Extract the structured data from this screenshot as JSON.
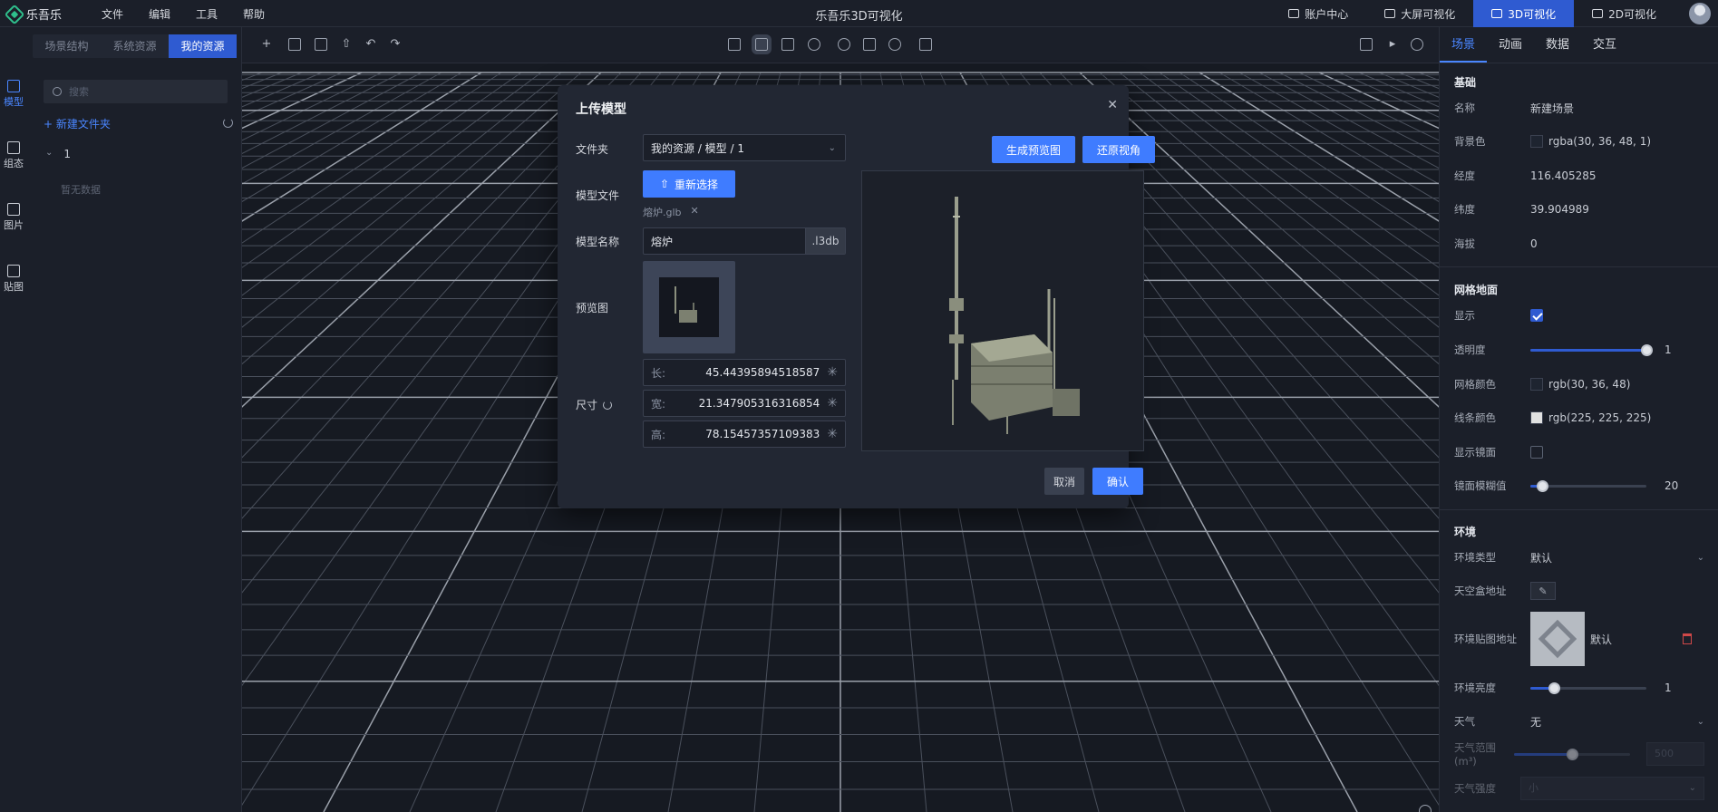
{
  "app": {
    "logo_text": "乐吾乐",
    "title": "乐吾乐3D可视化",
    "menu": [
      "文件",
      "编辑",
      "工具",
      "帮助"
    ],
    "top_links": [
      {
        "label": "账户中心",
        "active": false
      },
      {
        "label": "大屏可视化",
        "active": false
      },
      {
        "label": "3D可视化",
        "active": true
      },
      {
        "label": "2D可视化",
        "active": false
      }
    ]
  },
  "left_rail": [
    {
      "label": "模型",
      "active": true
    },
    {
      "label": "组态",
      "active": false
    },
    {
      "label": "图片",
      "active": false
    },
    {
      "label": "贴图",
      "active": false
    }
  ],
  "left_panel": {
    "tabs": [
      "场景结构",
      "系统资源",
      "我的资源"
    ],
    "active_tab": 2,
    "search_placeholder": "搜索",
    "new_folder": "+ 新建文件夹",
    "folder_name": "1",
    "empty_text": "暂无数据"
  },
  "right_panel": {
    "tabs": [
      "场景",
      "动画",
      "数据",
      "交互"
    ],
    "active_tab": 0,
    "basic": {
      "title": "基础",
      "name_label": "名称",
      "name_value": "新建场景",
      "bg_label": "背景色",
      "bg_value": "rgba(30, 36, 48, 1)",
      "bg_color": "#1e2430",
      "lng_label": "经度",
      "lng_value": "116.405285",
      "lat_label": "纬度",
      "lat_value": "39.904989",
      "alt_label": "海拔",
      "alt_value": "0"
    },
    "grid": {
      "title": "网格地面",
      "show_label": "显示",
      "show_checked": true,
      "opacity_label": "透明度",
      "opacity_value": "1",
      "opacity_fraction": 1.0,
      "gridcolor_label": "网格颜色",
      "gridcolor_value": "rgb(30, 36, 48)",
      "gridcolor_color": "#1e2430",
      "linecolor_label": "线条颜色",
      "linecolor_value": "rgb(225, 225, 225)",
      "linecolor_color": "#e1e1e1",
      "mirror_label": "显示镜面",
      "mirror_checked": false,
      "blur_label": "镜面模糊值",
      "blur_value": "20",
      "blur_fraction": 0.1
    },
    "env": {
      "title": "环境",
      "type_label": "环境类型",
      "type_value": "默认",
      "skybox_label": "天空盒地址",
      "envmap_label": "环境贴图地址",
      "envmap_value": "默认",
      "brightness_label": "环境亮度",
      "brightness_value": "1",
      "brightness_fraction": 0.2,
      "weather_label": "天气",
      "weather_value": "无",
      "range_label": "天气范围(m³)",
      "range_value": "500",
      "range_fraction": 0.5,
      "strength_label": "天气强度",
      "strength_value": "小"
    }
  },
  "modal": {
    "title": "上传模型",
    "folder_label": "文件夹",
    "folder_value": "我的资源 / 模型 /  1",
    "file_label": "模型文件",
    "reselect": "重新选择",
    "file_name": "熔炉.glb",
    "name_label": "模型名称",
    "name_value": "熔炉",
    "name_suffix": ".l3db",
    "preview_label": "预览图",
    "size_label": "尺寸",
    "dims": [
      {
        "label": "长:",
        "value": "45.44395894518587"
      },
      {
        "label": "宽:",
        "value": "21.347905316316854"
      },
      {
        "label": "高:",
        "value": "78.15457357109383"
      }
    ],
    "gen_preview": "生成预览图",
    "reset_view": "还原视角",
    "cancel": "取消",
    "confirm": "确认"
  }
}
